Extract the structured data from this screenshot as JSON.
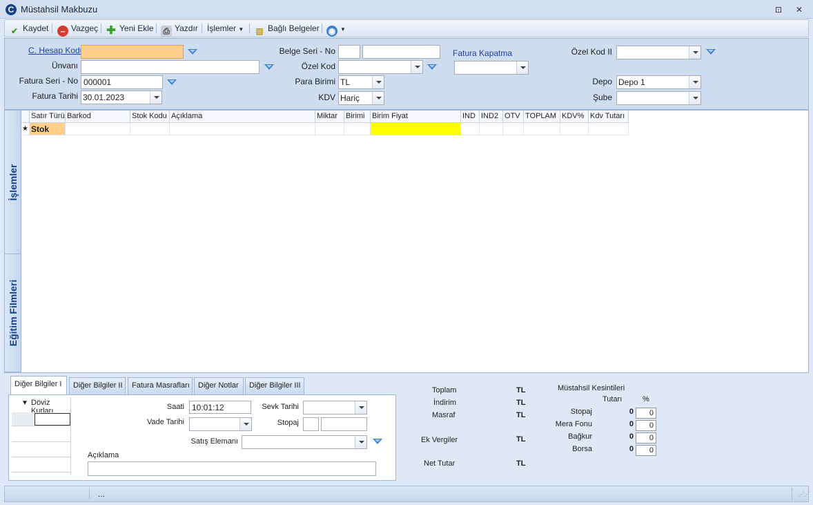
{
  "window": {
    "title": "Müstahsil Makbuzu",
    "minimize_glyph": "⊡",
    "close_glyph": "✕"
  },
  "toolbar": {
    "save": "Kaydet",
    "cancel": "Vazgeç",
    "add_new": "Yeni Ekle",
    "print": "Yazdır",
    "operations": "İşlemler",
    "linked_docs": "Bağlı Belgeler"
  },
  "header": {
    "cari_hesap_kodu_label": "C. Hesap Kodu",
    "cari_hesap_kodu_value": "",
    "unvan_label": "Ünvanı",
    "fatura_seri_no_label": "Fatura Seri - No",
    "fatura_seri_no_value": "000001",
    "fatura_tarihi_label": "Fatura Tarihi",
    "fatura_tarihi_value": "30.01.2023",
    "belge_seri_no_label": "Belge Seri - No",
    "ozel_kod_label": "Özel Kod",
    "para_birimi_label": "Para Birimi",
    "para_birimi_value": "TL",
    "kdv_label": "KDV",
    "kdv_value": "Hariç",
    "fatura_kapatma_label": "Fatura Kapatma",
    "ozel_kod2_label": "Özel Kod II",
    "depo_label": "Depo",
    "depo_value": "Depo 1",
    "sube_label": "Şube"
  },
  "side_tabs": {
    "islemler": "İşlemler",
    "egitim_filmleri": "Eğitim Filmleri"
  },
  "grid": {
    "columns": [
      "Satır Türü",
      "Barkod",
      "Stok Kodu",
      "Açıklama",
      "Miktar",
      "Birimi",
      "Birim Fiyat",
      "IND",
      "IND2",
      "OTV",
      "TOPLAM",
      "KDV%",
      "Kdv Tutarı"
    ],
    "new_row_marker": "★",
    "first_row_type": "Stok"
  },
  "bottom_tabs": [
    "Diğer Bilgiler I",
    "Diğer Bilgiler II",
    "Fatura Masrafları",
    "Diğer Notlar",
    "Diğer Bilgiler III"
  ],
  "other_info": {
    "doviz_kurlari": "Döviz Kurları",
    "saati_label": "Saati",
    "saati_value": "10:01:12",
    "sevk_tarihi_label": "Sevk Tarihi",
    "vade_tarihi_label": "Vade Tarihi",
    "stopaj_label": "Stopaj",
    "satis_elemani_label": "Satış Elemanı",
    "aciklama_label": "Açıklama"
  },
  "totals": {
    "toplam_label": "Toplam",
    "indirim_label": "İndirim",
    "masraf_label": "Masraf",
    "ek_vergiler_label": "Ek Vergiler",
    "net_tutar_label": "Net Tutar",
    "currency": "TL"
  },
  "kesintiler": {
    "title": "Müstahsil Kesintileri",
    "tutari_label": "Tutarı",
    "pct_label": "%",
    "rows": [
      {
        "label": "Stopaj",
        "amount": "0",
        "pct": "0"
      },
      {
        "label": "Mera Fonu",
        "amount": "0",
        "pct": "0"
      },
      {
        "label": "Bağkur",
        "amount": "0",
        "pct": "0"
      },
      {
        "label": "Borsa",
        "amount": "0",
        "pct": "0"
      }
    ]
  },
  "status": {
    "text": "..."
  },
  "colors": {
    "focus_field": "#ffcf8c",
    "price_cell": "#ffff00",
    "stok_cell": "#ffcf8c",
    "accent": "#15428b"
  }
}
